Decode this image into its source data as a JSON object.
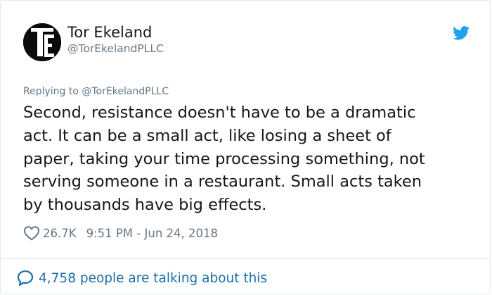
{
  "author": {
    "name": "Tor Ekeland",
    "handle": "@TorEkelandPLLC",
    "avatar_letters": "TE"
  },
  "reply": {
    "text": "Replying to @TorEkelandPLLC"
  },
  "tweet": {
    "lines": [
      "Second, resistance doesn't have to be a dramatic",
      "act. It can be a small act, like losing a sheet of",
      "paper, taking your time processing something, not",
      "serving someone in a restaurant. Small acts taken",
      "by thousands have big effects."
    ]
  },
  "meta": {
    "likes": "26.7K",
    "timestamp": "9:51 PM - Jun 24, 2018"
  },
  "footer": {
    "talking_text": "4,758 people are talking about this"
  },
  "icons": {
    "brand": "twitter-bird-icon",
    "like": "heart-outline-icon",
    "reply": "speech-bubble-icon"
  },
  "colors": {
    "twitter_blue": "#1da1f2",
    "link_blue": "#1b6fa8",
    "secondary_text": "#657786",
    "primary_text": "#14171a",
    "border": "#e1e8ed"
  }
}
